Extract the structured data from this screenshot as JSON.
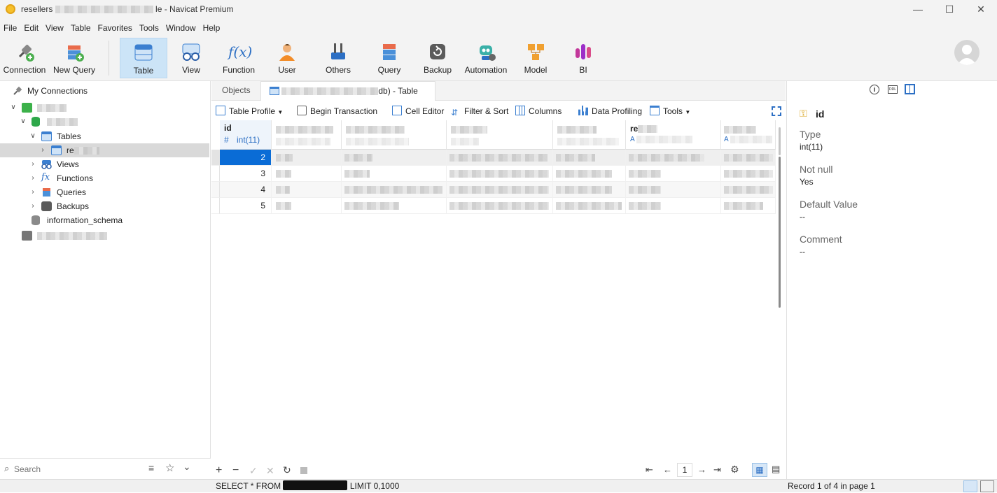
{
  "window": {
    "title_prefix": "resellers",
    "title_suffix": "le - Navicat Premium",
    "min": "—",
    "max": "☐",
    "close": "✕"
  },
  "menu": [
    "File",
    "Edit",
    "View",
    "Table",
    "Favorites",
    "Tools",
    "Window",
    "Help"
  ],
  "toolbar": {
    "connection": "Connection",
    "new_query": "New Query",
    "table": "Table",
    "view": "View",
    "function": "Function",
    "user": "User",
    "others": "Others",
    "query": "Query",
    "backup": "Backup",
    "automation": "Automation",
    "model": "Model",
    "bi": "BI"
  },
  "tree": {
    "root": "My Connections",
    "tables": "Tables",
    "table_item": "re",
    "views": "Views",
    "functions": "Functions",
    "queries": "Queries",
    "backups": "Backups",
    "info_schema": "information_schema"
  },
  "search_placeholder": "Search",
  "tabs": {
    "objects": "Objects",
    "table_tab_suffix": "db) - Table"
  },
  "subtoolbar": {
    "table_profile": "Table Profile",
    "begin_transaction": "Begin Transaction",
    "cell_editor": "Cell Editor",
    "filter_sort": "Filter & Sort",
    "columns": "Columns",
    "data_profiling": "Data Profiling",
    "tools": "Tools"
  },
  "grid": {
    "id_header": "id",
    "id_type_symbol": "#",
    "id_type": "int(11)",
    "col5_header_prefix": "re",
    "col5_type_prefix": "A",
    "col6_type_prefix": "A",
    "ids": [
      "2",
      "3",
      "4",
      "5"
    ]
  },
  "pager": {
    "page": "1"
  },
  "statusbar": {
    "sql_prefix": "SELECT * FROM",
    "sql_suffix": "LIMIT 0,1000",
    "record_info": "Record 1 of 4 in page 1"
  },
  "properties": {
    "field_name": "id",
    "type_label": "Type",
    "type_value": "int(11)",
    "notnull_label": "Not null",
    "notnull_value": "Yes",
    "default_label": "Default Value",
    "default_value": "--",
    "comment_label": "Comment",
    "comment_value": "--"
  },
  "colors": {
    "selection": "#0a6cd6",
    "active_tool": "#cce4f7",
    "key_icon": "#d9a520"
  }
}
